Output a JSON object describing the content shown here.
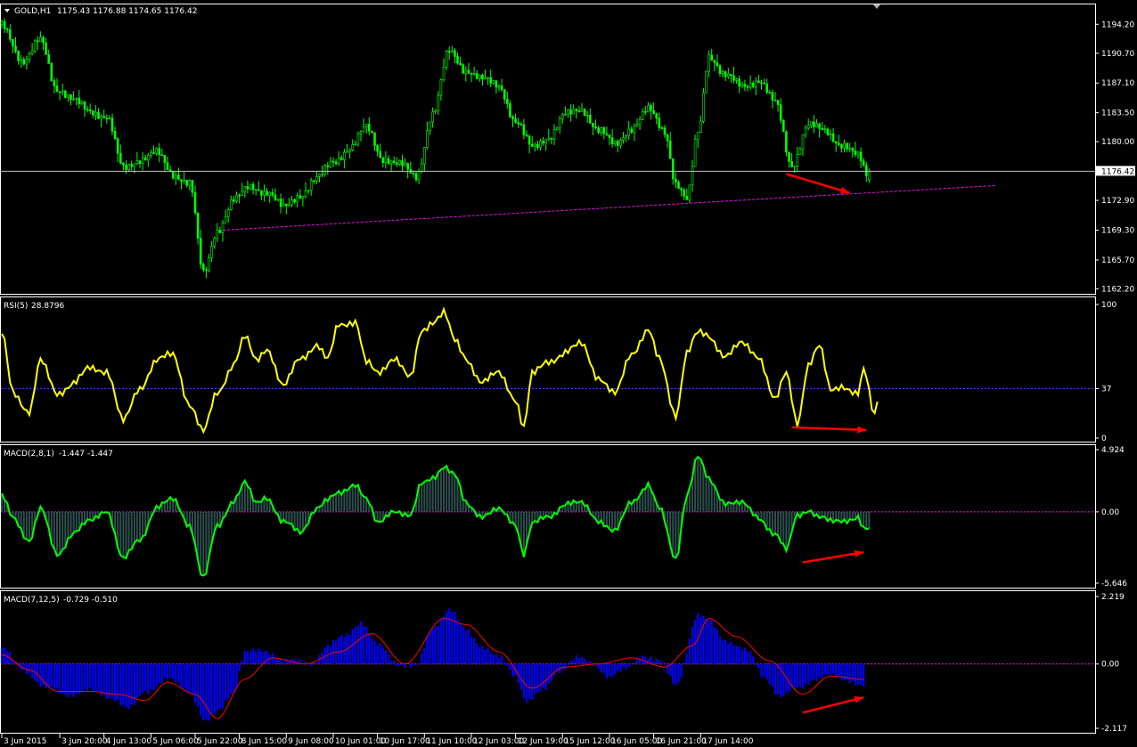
{
  "window": {
    "symbol_header": "GOLD,H1",
    "ohlc": "1175.43 1176.88 1174.65 1176.42"
  },
  "colors": {
    "background": "#000000",
    "frame": "#ffffff",
    "candle": "#00ff00",
    "current_price_line": "#c0c0c0",
    "trendline": "#ff00ff",
    "rsi_line": "#ffff00",
    "rsi_level": "#4040ff",
    "macd1_line": "#00ff00",
    "macd1_hist": "#2f4f4f",
    "macd2_hist": "#0000ff",
    "macd2_signal": "#ff0000",
    "annotation_arrow": "#ff0000"
  },
  "chart_data": [
    {
      "type": "candlestick",
      "name": "GOLD,H1",
      "ylim": [
        1161.6,
        1196.6
      ],
      "y_ticks": [
        1194.2,
        1190.7,
        1187.1,
        1183.5,
        1180.0,
        1172.9,
        1169.3,
        1165.7,
        1162.2
      ],
      "current_price": "1176.42",
      "close_anchors": [
        [
          0,
          1194.2
        ],
        [
          8,
          1189.6
        ],
        [
          14,
          1192.3
        ],
        [
          20,
          1186.4
        ],
        [
          26,
          1184.9
        ],
        [
          32,
          1183.8
        ],
        [
          38,
          1182.9
        ],
        [
          44,
          1176.8
        ],
        [
          50,
          1177.9
        ],
        [
          56,
          1178.6
        ],
        [
          62,
          1176.1
        ],
        [
          68,
          1175.0
        ],
        [
          73,
          1164.0
        ],
        [
          78,
          1169.3
        ],
        [
          84,
          1172.9
        ],
        [
          90,
          1174.6
        ],
        [
          96,
          1173.9
        ],
        [
          102,
          1172.0
        ],
        [
          108,
          1173.6
        ],
        [
          114,
          1175.5
        ],
        [
          120,
          1177.6
        ],
        [
          126,
          1179.2
        ],
        [
          132,
          1181.7
        ],
        [
          138,
          1178.0
        ],
        [
          144,
          1177.2
        ],
        [
          150,
          1175.8
        ],
        [
          156,
          1183.4
        ],
        [
          162,
          1190.9
        ],
        [
          168,
          1188.7
        ],
        [
          174,
          1187.5
        ],
        [
          180,
          1186.8
        ],
        [
          186,
          1182.4
        ],
        [
          192,
          1179.3
        ],
        [
          198,
          1180.6
        ],
        [
          204,
          1183.2
        ],
        [
          210,
          1183.9
        ],
        [
          216,
          1181.4
        ],
        [
          222,
          1179.6
        ],
        [
          228,
          1181.7
        ],
        [
          234,
          1183.8
        ],
        [
          240,
          1181.3
        ],
        [
          244,
          1175.0
        ],
        [
          248,
          1172.9
        ],
        [
          252,
          1181.1
        ],
        [
          256,
          1190.5
        ],
        [
          262,
          1187.9
        ],
        [
          268,
          1186.8
        ],
        [
          274,
          1187.4
        ],
        [
          280,
          1184.7
        ],
        [
          286,
          1177.2
        ],
        [
          292,
          1181.9
        ],
        [
          298,
          1181.4
        ],
        [
          304,
          1179.6
        ],
        [
          310,
          1178.2
        ],
        [
          314,
          1175.6
        ]
      ],
      "trendline": {
        "from": [
          80,
          1169.3
        ],
        "to": [
          360,
          1174.7
        ]
      },
      "annotation_arrow": {
        "from": [
          284,
          1176.1
        ],
        "to": [
          307,
          1173.8
        ]
      }
    },
    {
      "type": "line",
      "name": "RSI(5)",
      "value_label": "28.8796",
      "ylim": [
        0,
        100
      ],
      "y_ticks": [
        100,
        37,
        0
      ],
      "level": 37,
      "anchors": [
        [
          0,
          78
        ],
        [
          4,
          35
        ],
        [
          10,
          20
        ],
        [
          14,
          57
        ],
        [
          20,
          34
        ],
        [
          26,
          41
        ],
        [
          32,
          52
        ],
        [
          38,
          51
        ],
        [
          44,
          12
        ],
        [
          50,
          38
        ],
        [
          56,
          58
        ],
        [
          62,
          62
        ],
        [
          68,
          26
        ],
        [
          73,
          4
        ],
        [
          78,
          34
        ],
        [
          84,
          56
        ],
        [
          88,
          75
        ],
        [
          92,
          58
        ],
        [
          96,
          68
        ],
        [
          102,
          38
        ],
        [
          108,
          60
        ],
        [
          114,
          70
        ],
        [
          118,
          58
        ],
        [
          122,
          85
        ],
        [
          128,
          88
        ],
        [
          132,
          56
        ],
        [
          136,
          48
        ],
        [
          142,
          61
        ],
        [
          148,
          44
        ],
        [
          152,
          80
        ],
        [
          156,
          88
        ],
        [
          160,
          94
        ],
        [
          164,
          72
        ],
        [
          168,
          60
        ],
        [
          174,
          42
        ],
        [
          180,
          48
        ],
        [
          186,
          30
        ],
        [
          189,
          8
        ],
        [
          192,
          47
        ],
        [
          198,
          58
        ],
        [
          204,
          64
        ],
        [
          210,
          70
        ],
        [
          216,
          46
        ],
        [
          222,
          32
        ],
        [
          228,
          64
        ],
        [
          234,
          81
        ],
        [
          238,
          58
        ],
        [
          244,
          18
        ],
        [
          248,
          64
        ],
        [
          252,
          78
        ],
        [
          256,
          76
        ],
        [
          262,
          62
        ],
        [
          268,
          70
        ],
        [
          274,
          62
        ],
        [
          280,
          28
        ],
        [
          284,
          48
        ],
        [
          288,
          12
        ],
        [
          292,
          55
        ],
        [
          296,
          68
        ],
        [
          300,
          36
        ],
        [
          304,
          40
        ],
        [
          310,
          32
        ],
        [
          312,
          50
        ],
        [
          316,
          18
        ],
        [
          317,
          28.9
        ]
      ],
      "annotation_arrow": {
        "from": [
          286,
          8
        ],
        "to": [
          313,
          6
        ]
      }
    },
    {
      "type": "line+histogram",
      "name": "MACD(2,8,1)",
      "value_label": "-1.447 -1.447",
      "ylim": [
        -5.646,
        4.924
      ],
      "y_ticks": [
        "4.924",
        "0.00",
        "-5.646"
      ],
      "anchors": [
        [
          0,
          1.2
        ],
        [
          4,
          -0.5
        ],
        [
          10,
          -2.2
        ],
        [
          14,
          0.2
        ],
        [
          20,
          -3.4
        ],
        [
          26,
          -1.6
        ],
        [
          32,
          -0.8
        ],
        [
          38,
          0.2
        ],
        [
          44,
          -3.8
        ],
        [
          50,
          -2.2
        ],
        [
          56,
          0.4
        ],
        [
          62,
          0.9
        ],
        [
          68,
          -1.0
        ],
        [
          73,
          -5.3
        ],
        [
          78,
          -1.2
        ],
        [
          84,
          1.0
        ],
        [
          88,
          2.3
        ],
        [
          92,
          0.6
        ],
        [
          96,
          1.2
        ],
        [
          102,
          -0.8
        ],
        [
          108,
          -1.7
        ],
        [
          114,
          0.4
        ],
        [
          118,
          0.9
        ],
        [
          122,
          1.4
        ],
        [
          128,
          2.3
        ],
        [
          132,
          1.0
        ],
        [
          136,
          -1.0
        ],
        [
          142,
          0.2
        ],
        [
          148,
          -0.4
        ],
        [
          152,
          2.2
        ],
        [
          156,
          2.8
        ],
        [
          160,
          3.6
        ],
        [
          164,
          2.8
        ],
        [
          168,
          0.7
        ],
        [
          174,
          -0.3
        ],
        [
          180,
          0.1
        ],
        [
          186,
          -0.9
        ],
        [
          189,
          -3.3
        ],
        [
          192,
          -1.0
        ],
        [
          198,
          -0.4
        ],
        [
          204,
          0.7
        ],
        [
          210,
          0.6
        ],
        [
          216,
          -0.6
        ],
        [
          222,
          -1.6
        ],
        [
          228,
          0.8
        ],
        [
          234,
          2.2
        ],
        [
          238,
          0.2
        ],
        [
          244,
          -3.7
        ],
        [
          248,
          1.4
        ],
        [
          252,
          4.3
        ],
        [
          256,
          2.5
        ],
        [
          262,
          0.8
        ],
        [
          268,
          0.6
        ],
        [
          274,
          -0.4
        ],
        [
          280,
          -1.8
        ],
        [
          284,
          -3.1
        ],
        [
          288,
          -0.2
        ],
        [
          292,
          0.2
        ],
        [
          296,
          -0.5
        ],
        [
          300,
          -0.8
        ],
        [
          304,
          -0.6
        ],
        [
          310,
          -0.5
        ],
        [
          312,
          -1.5
        ],
        [
          314,
          -1.447
        ]
      ],
      "annotation_arrow": {
        "from": [
          290,
          -4.0
        ],
        "to": [
          312,
          -3.2
        ]
      }
    },
    {
      "type": "histogram+line",
      "name": "MACD(7,12,5)",
      "value_label": "-0.729 -0.510",
      "ylim": [
        -2.117,
        2.219
      ],
      "y_ticks": [
        "2.219",
        "0.00",
        "-2.117"
      ],
      "hist_anchors": [
        [
          0,
          0.5
        ],
        [
          8,
          -0.2
        ],
        [
          16,
          -0.8
        ],
        [
          24,
          -1.0
        ],
        [
          32,
          -0.9
        ],
        [
          40,
          -1.1
        ],
        [
          46,
          -1.5
        ],
        [
          52,
          -0.9
        ],
        [
          60,
          -0.5
        ],
        [
          68,
          -0.9
        ],
        [
          74,
          -1.9
        ],
        [
          78,
          -1.6
        ],
        [
          84,
          -0.9
        ],
        [
          88,
          0.4
        ],
        [
          96,
          0.4
        ],
        [
          104,
          0.1
        ],
        [
          112,
          0.0
        ],
        [
          118,
          0.6
        ],
        [
          124,
          0.9
        ],
        [
          130,
          1.4
        ],
        [
          136,
          0.6
        ],
        [
          144,
          0.0
        ],
        [
          150,
          -0.1
        ],
        [
          156,
          1.2
        ],
        [
          162,
          1.8
        ],
        [
          168,
          1.1
        ],
        [
          174,
          0.6
        ],
        [
          180,
          0.2
        ],
        [
          186,
          -0.4
        ],
        [
          190,
          -1.2
        ],
        [
          196,
          -0.9
        ],
        [
          202,
          -0.2
        ],
        [
          208,
          0.2
        ],
        [
          214,
          0.0
        ],
        [
          220,
          -0.4
        ],
        [
          226,
          -0.2
        ],
        [
          232,
          0.3
        ],
        [
          238,
          0.1
        ],
        [
          244,
          -0.7
        ],
        [
          252,
          1.6
        ],
        [
          256,
          1.4
        ],
        [
          262,
          0.8
        ],
        [
          270,
          0.4
        ],
        [
          276,
          -0.4
        ],
        [
          282,
          -1.1
        ],
        [
          288,
          -0.8
        ],
        [
          294,
          -0.5
        ],
        [
          300,
          -0.4
        ],
        [
          306,
          -0.5
        ],
        [
          312,
          -0.729
        ]
      ],
      "signal_anchors": [
        [
          0,
          0.3
        ],
        [
          10,
          -0.2
        ],
        [
          20,
          -0.9
        ],
        [
          32,
          -0.9
        ],
        [
          42,
          -1.0
        ],
        [
          52,
          -1.2
        ],
        [
          60,
          -0.6
        ],
        [
          70,
          -1.0
        ],
        [
          78,
          -1.8
        ],
        [
          88,
          -0.5
        ],
        [
          98,
          0.2
        ],
        [
          110,
          0.0
        ],
        [
          122,
          0.4
        ],
        [
          134,
          1.0
        ],
        [
          146,
          0.0
        ],
        [
          160,
          1.5
        ],
        [
          168,
          1.3
        ],
        [
          180,
          0.4
        ],
        [
          192,
          -0.8
        ],
        [
          204,
          -0.1
        ],
        [
          216,
          0.0
        ],
        [
          228,
          0.2
        ],
        [
          240,
          -0.1
        ],
        [
          250,
          0.6
        ],
        [
          256,
          1.5
        ],
        [
          266,
          0.9
        ],
        [
          278,
          0.1
        ],
        [
          290,
          -1.0
        ],
        [
          300,
          -0.4
        ],
        [
          312,
          -0.51
        ]
      ],
      "annotation_arrow": {
        "from": [
          290,
          -1.6
        ],
        "to": [
          312,
          -1.1
        ]
      }
    }
  ],
  "x_axis": {
    "labels": [
      {
        "bar": 0,
        "text": "3 Jun 2015"
      },
      {
        "bar": 21,
        "text": "3 Jun 20:00"
      },
      {
        "bar": 37,
        "text": "4 Jun 13:00"
      },
      {
        "bar": 54,
        "text": "5 Jun 06:00"
      },
      {
        "bar": 70,
        "text": "5 Jun 22:00"
      },
      {
        "bar": 86,
        "text": "8 Jun 15:00"
      },
      {
        "bar": 103,
        "text": "9 Jun 08:00"
      },
      {
        "bar": 120,
        "text": "10 Jun 01:00"
      },
      {
        "bar": 136,
        "text": "10 Jun 17:00"
      },
      {
        "bar": 153,
        "text": "11 Jun 10:00"
      },
      {
        "bar": 170,
        "text": "12 Jun 03:00"
      },
      {
        "bar": 186,
        "text": "12 Jun 19:00"
      },
      {
        "bar": 203,
        "text": "15 Jun 12:00"
      },
      {
        "bar": 220,
        "text": "16 Jun 05:00"
      },
      {
        "bar": 236,
        "text": "16 Jun 21:00"
      },
      {
        "bar": 253,
        "text": "17 Jun 14:00"
      }
    ]
  }
}
